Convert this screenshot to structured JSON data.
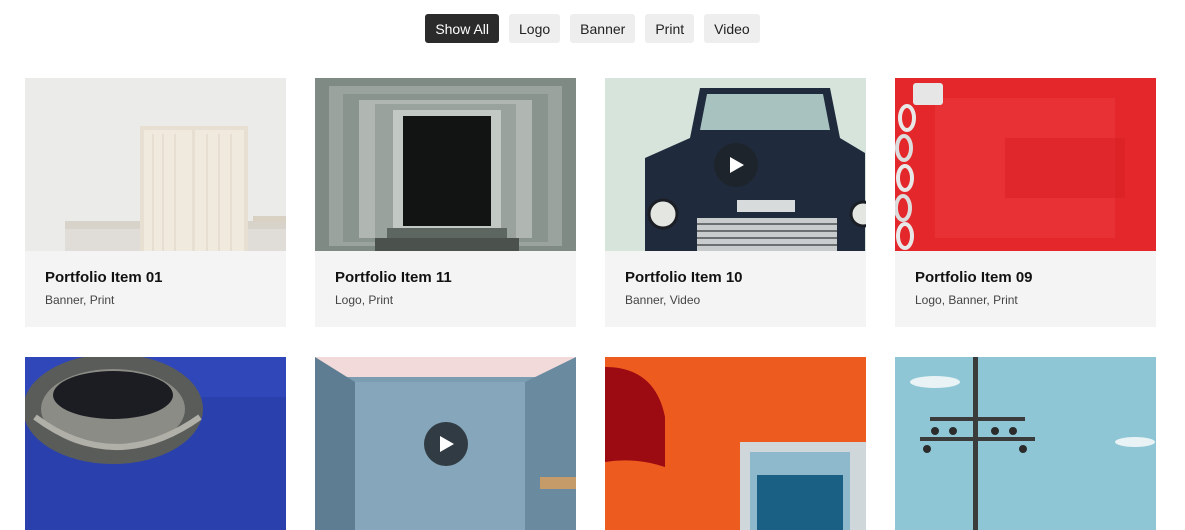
{
  "filters": [
    {
      "label": "Show All",
      "active": true
    },
    {
      "label": "Logo",
      "active": false
    },
    {
      "label": "Banner",
      "active": false
    },
    {
      "label": "Print",
      "active": false
    },
    {
      "label": "Video",
      "active": false
    }
  ],
  "items": [
    {
      "title": "Portfolio Item 01",
      "categories": "Banner, Print",
      "video": false
    },
    {
      "title": "Portfolio Item 11",
      "categories": "Logo, Print",
      "video": false
    },
    {
      "title": "Portfolio Item 10",
      "categories": "Banner, Video",
      "video": true
    },
    {
      "title": "Portfolio Item 09",
      "categories": "Logo, Banner, Print",
      "video": false
    },
    {
      "title": "",
      "categories": "",
      "video": false
    },
    {
      "title": "",
      "categories": "",
      "video": true
    },
    {
      "title": "",
      "categories": "",
      "video": false
    },
    {
      "title": "",
      "categories": "",
      "video": false
    }
  ],
  "colors": {
    "active_filter_bg": "#2b2b2b",
    "filter_bg": "#eeeeee",
    "card_bg": "#f4f4f4"
  }
}
